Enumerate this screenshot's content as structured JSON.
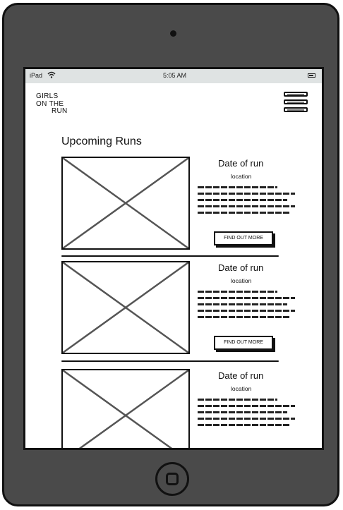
{
  "status_bar": {
    "device": "iPad",
    "time": "5:05 AM"
  },
  "header": {
    "logo_lines": [
      "GIRLS",
      "ON THE",
      "RUN"
    ],
    "menu_icon": "hamburger-menu-icon"
  },
  "page": {
    "title": "Upcoming Runs"
  },
  "runs": [
    {
      "title": "Date of run",
      "location": "location",
      "cta": "FIND OUT MORE"
    },
    {
      "title": "Date of run",
      "location": "location",
      "cta": "FIND OUT MORE"
    },
    {
      "title": "Date of run",
      "location": "location",
      "cta": ""
    }
  ],
  "colors": {
    "device_frame": "#4a4a4a",
    "status_bar": "#dfe3e3",
    "ink": "#111111"
  }
}
